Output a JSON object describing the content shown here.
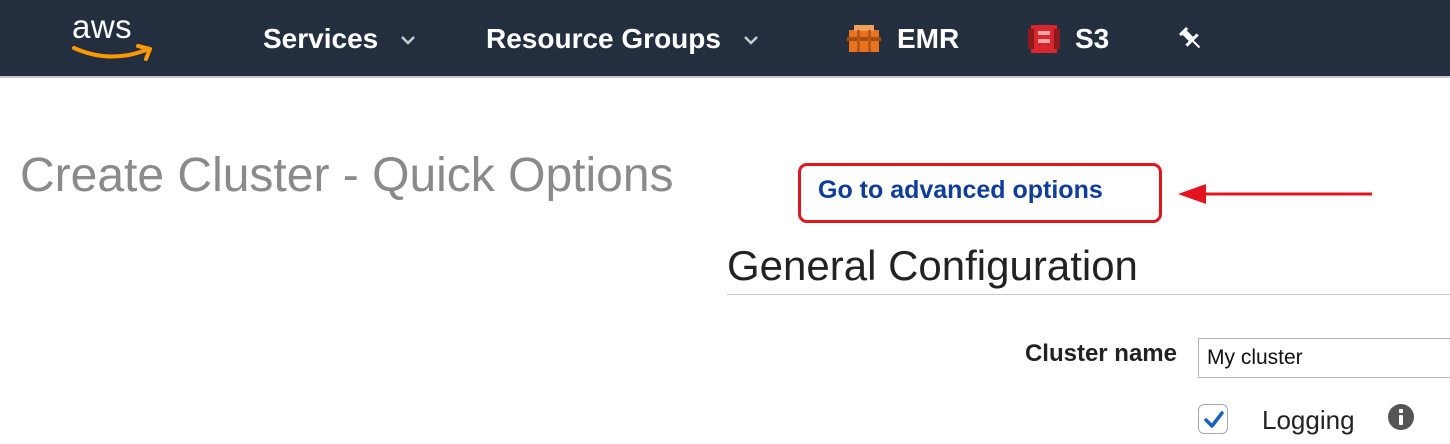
{
  "topnav": {
    "logo_text": "aws",
    "services_label": "Services",
    "resource_groups_label": "Resource Groups",
    "pinned": [
      {
        "label": "EMR",
        "icon": "emr-icon",
        "color": "#e8731e"
      },
      {
        "label": "S3",
        "icon": "s3-bucket-icon",
        "color": "#d9272d"
      }
    ],
    "pin_icon": "pushpin-icon",
    "background": "#232f3e",
    "logo_accent": "#ff9900"
  },
  "page": {
    "title": "Create Cluster - Quick Options",
    "advanced_link": "Go to advanced options",
    "highlight_color": "#e3141e"
  },
  "general": {
    "section_title": "General Configuration",
    "cluster_name_label": "Cluster name",
    "cluster_name_value": "My cluster",
    "logging_label": "Logging",
    "logging_checked": true
  }
}
